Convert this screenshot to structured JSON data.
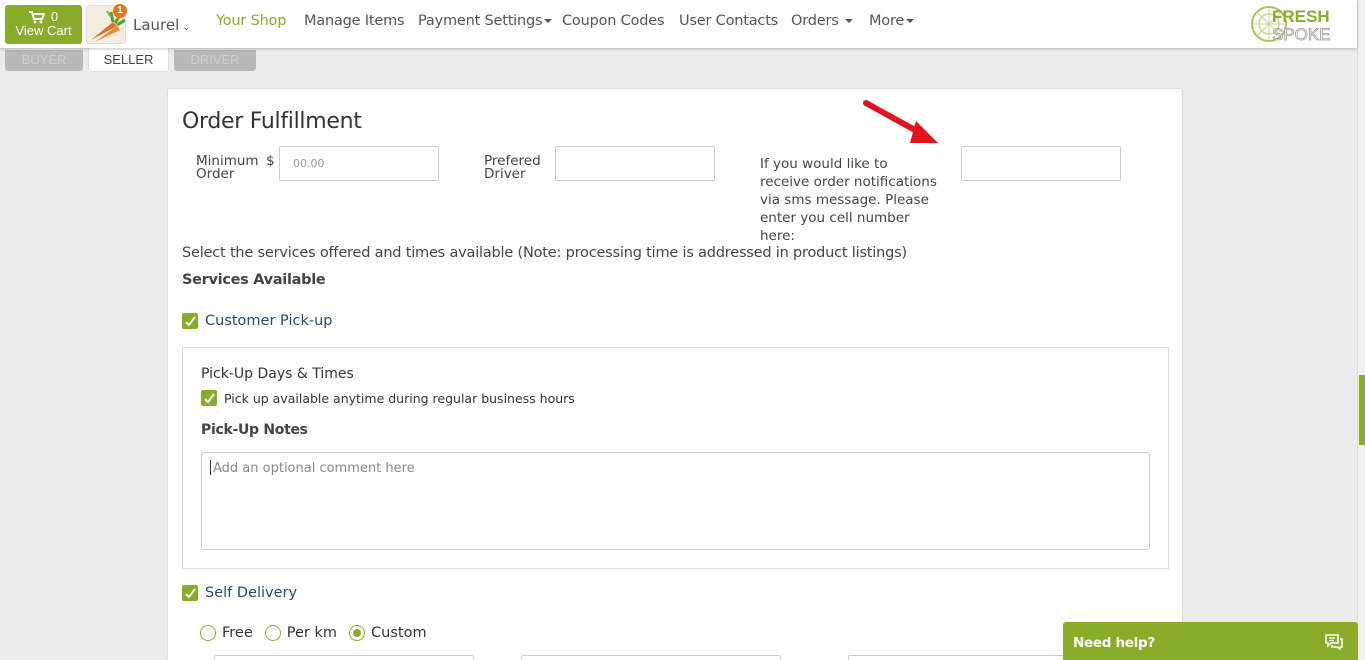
{
  "nav": {
    "cart_count": "0",
    "cart_label": "View Cart",
    "avatar_badge": "1",
    "user_name": "Laurel",
    "links": [
      "Your Shop",
      "Manage Items",
      "Payment Settings",
      "Coupon Codes",
      "User Contacts",
      "Orders",
      "More"
    ],
    "logo_top": "FRESH",
    "logo_bottom": "SPOKE"
  },
  "roles": {
    "buyer": "BUYER",
    "seller": "SELLER",
    "driver": "DRIVER"
  },
  "form": {
    "title": "Order Fulfillment",
    "min_order_label_1": "Minimum",
    "min_order_label_2": "Order",
    "currency": "$",
    "min_order_placeholder": "00.00",
    "driver_label_1": "Prefered",
    "driver_label_2": "Driver",
    "sms_text": "If you would like to receive order notifications via sms message. Please enter you cell number here:",
    "services_note": "Select the services offered and times available (Note: processing time is addressed in product listings)",
    "services_head": "Services Available",
    "customer_pickup": "Customer Pick-up",
    "pickup_days_head": "Pick-Up Days & Times",
    "pickup_anytime": "Pick up available anytime during regular business hours",
    "pickup_notes_head": "Pick-Up Notes",
    "pickup_notes_placeholder": "Add an optional comment here",
    "self_delivery": "Self Delivery",
    "delivery_options": [
      "Free",
      "Per km",
      "Custom"
    ],
    "delivery_selected": "Custom"
  },
  "help": {
    "label": "Need help?"
  },
  "colors": {
    "accent": "#8aac2b",
    "arrow": "#e0141e",
    "badge": "#e8731c"
  }
}
